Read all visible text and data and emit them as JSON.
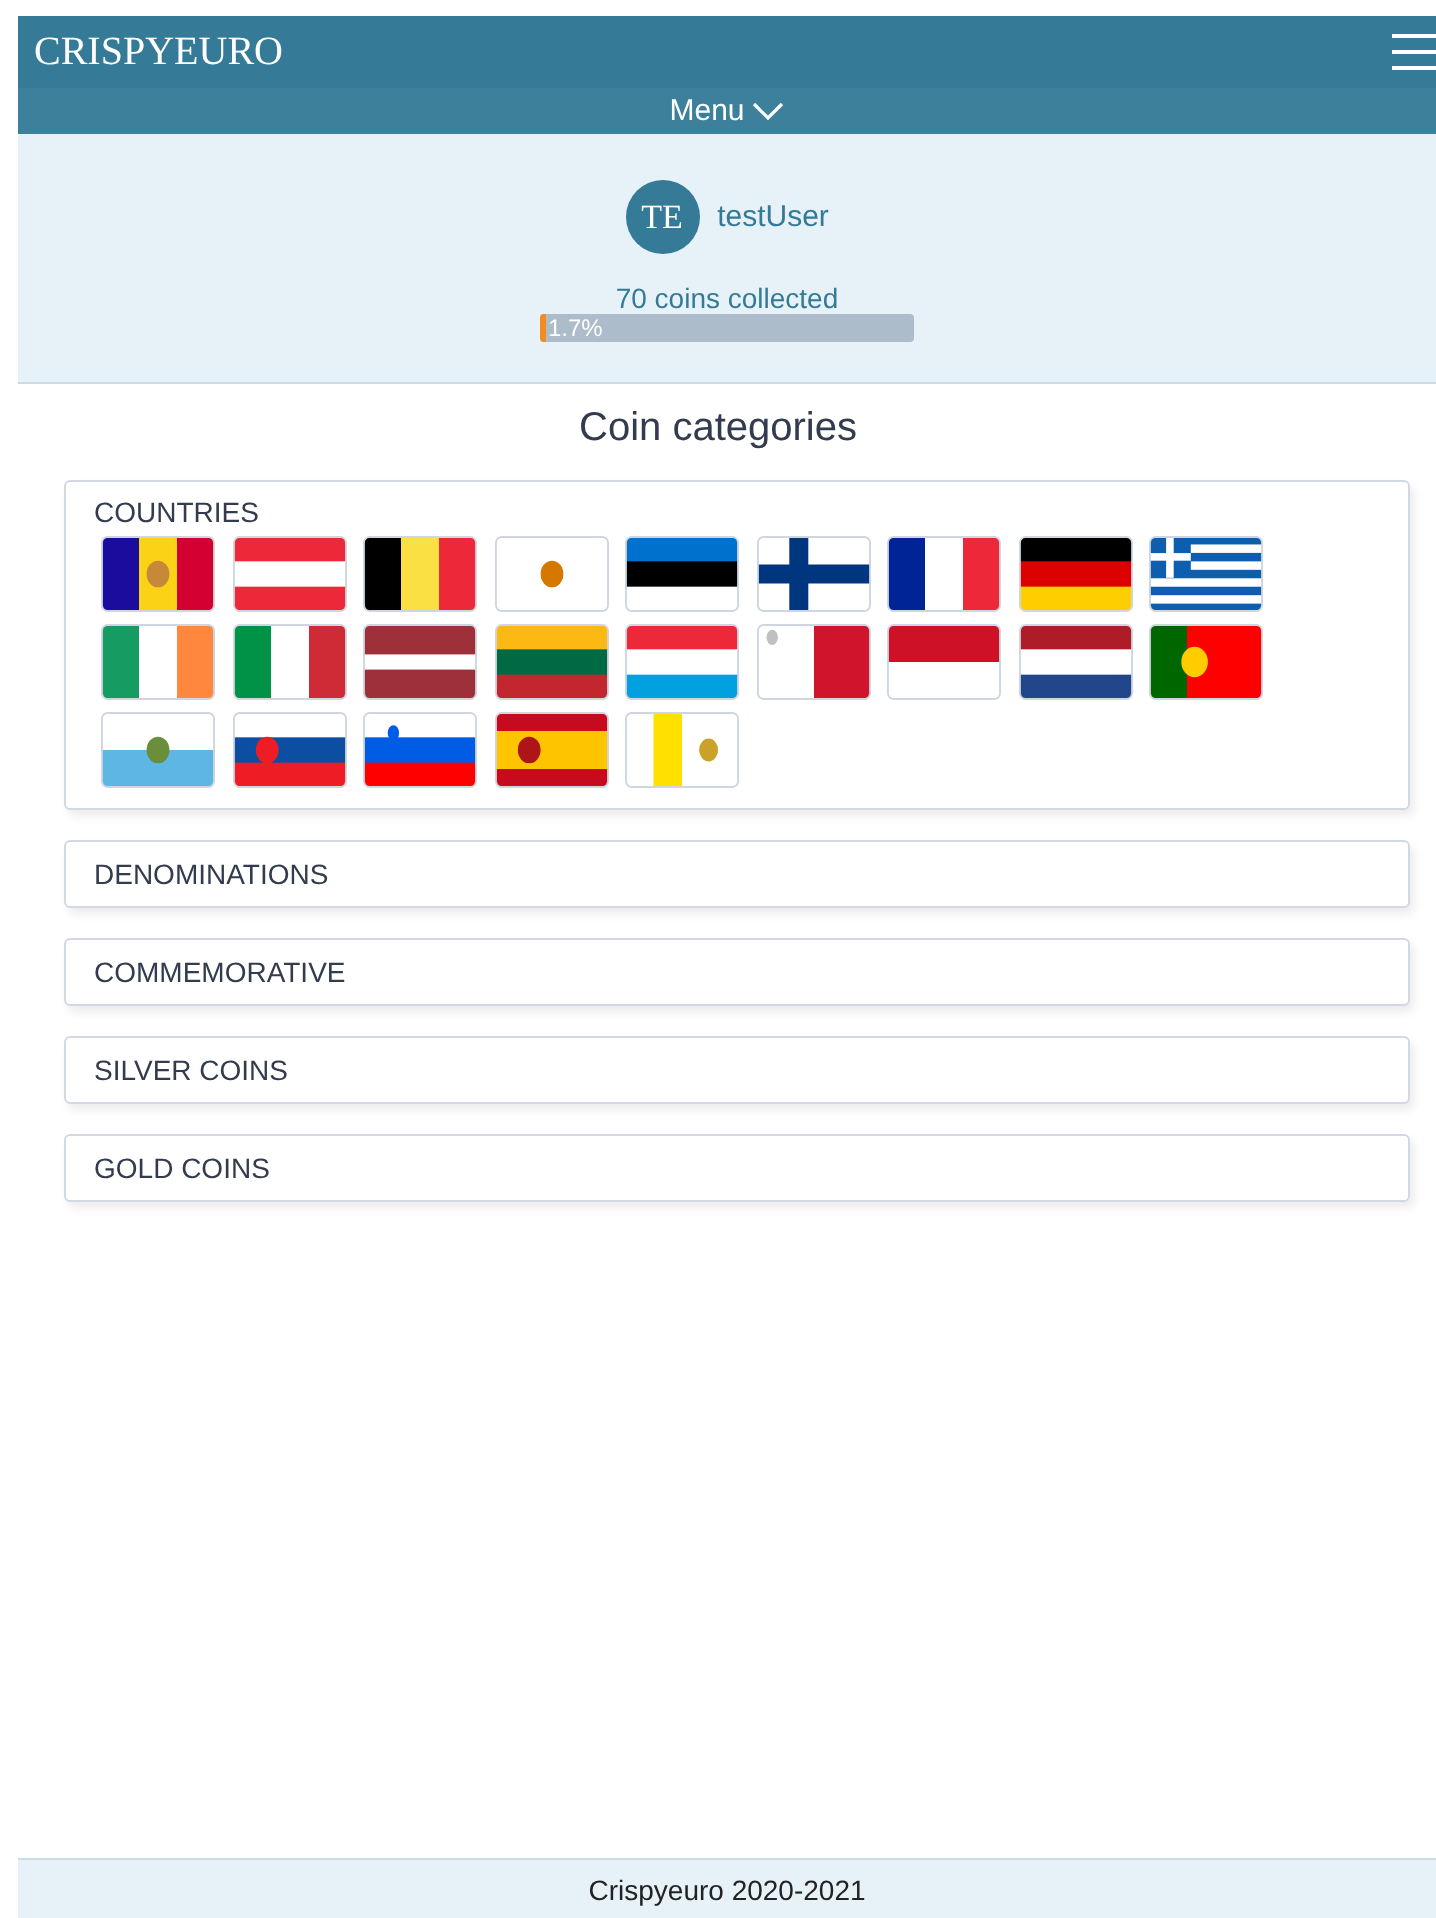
{
  "header": {
    "title": "CRISPYEURO",
    "menu_label": "Menu"
  },
  "profile": {
    "initials": "TE",
    "username": "testUser",
    "collected": "70 coins collected",
    "level": 0.017,
    "reading": "1.7%"
  },
  "categories_title": "Coin categories",
  "categories": [
    {
      "label": "COUNTRIES",
      "expanded": true
    },
    {
      "label": "DENOMINATIONS",
      "expanded": false
    },
    {
      "label": "COMMEMORATIVE",
      "expanded": false
    },
    {
      "label": "SILVER COINS",
      "expanded": false
    },
    {
      "label": "GOLD COINS",
      "expanded": false
    }
  ],
  "footer": "Crispyeuro 2020-2021"
}
